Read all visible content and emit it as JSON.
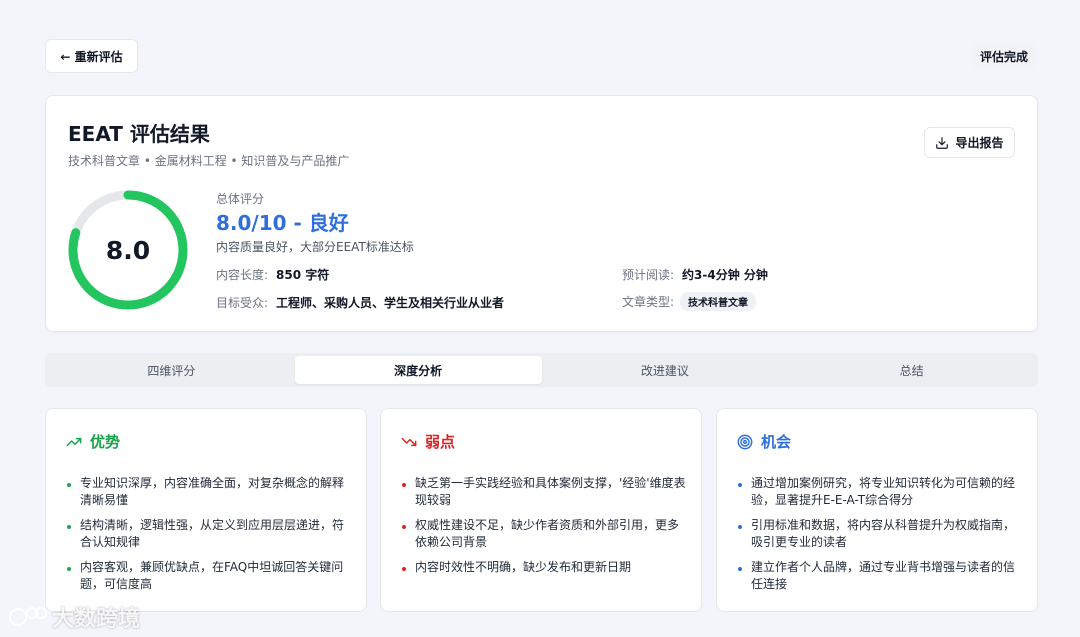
{
  "header": {
    "back_label": "← 重新评估",
    "status_label": "评估完成"
  },
  "result": {
    "title": "EEAT 评估结果",
    "subtitle": "技术科普文章 • 金属材料工程 • 知识普及与产品推广",
    "export_label": "导出报告",
    "score_value": 8.0,
    "score_display": "8.0",
    "score_max": 10,
    "overall_label": "总体评分",
    "overall_score": "8.0/10 - 良好",
    "overall_desc": "内容质量良好，大部分EEAT标准达标",
    "length_label": "内容长度:",
    "length_value": "850 字符",
    "read_label": "预计阅读:",
    "read_value": "约3-4分钟 分钟",
    "audience_label": "目标受众:",
    "audience_value": "工程师、采购人员、学生及相关行业从业者",
    "type_label": "文章类型:",
    "type_value": "技术科普文章"
  },
  "tabs": [
    {
      "label": "四维评分",
      "active": false
    },
    {
      "label": "深度分析",
      "active": true
    },
    {
      "label": "改进建议",
      "active": false
    },
    {
      "label": "总结",
      "active": false
    }
  ],
  "panels": {
    "strengths": {
      "title": "优势",
      "items": [
        "专业知识深厚，内容准确全面，对复杂概念的解释清晰易懂",
        "结构清晰，逻辑性强，从定义到应用层层递进，符合认知规律",
        "内容客观，兼顾优缺点，在FAQ中坦诚回答关键问题，可信度高"
      ]
    },
    "weaknesses": {
      "title": "弱点",
      "items": [
        "缺乏第一手实践经验和具体案例支撑，'经验'维度表现较弱",
        "权威性建设不足，缺少作者资质和外部引用，更多依赖公司背景",
        "内容时效性不明确，缺少发布和更新日期"
      ]
    },
    "opportunities": {
      "title": "机会",
      "items": [
        "通过增加案例研究，将专业知识转化为可信赖的经验，显著提升E-E-A-T综合得分",
        "引用标准和数据，将内容从科普提升为权威指南，吸引更专业的读者",
        "建立作者个人品牌，通过专业背书增强与读者的信任连接"
      ]
    }
  },
  "watermark": "大数跨境",
  "colors": {
    "accent_blue": "#2f6fd9",
    "success_green": "#22c55e",
    "danger_red": "#dc2626",
    "strength_green": "#16a34a"
  }
}
